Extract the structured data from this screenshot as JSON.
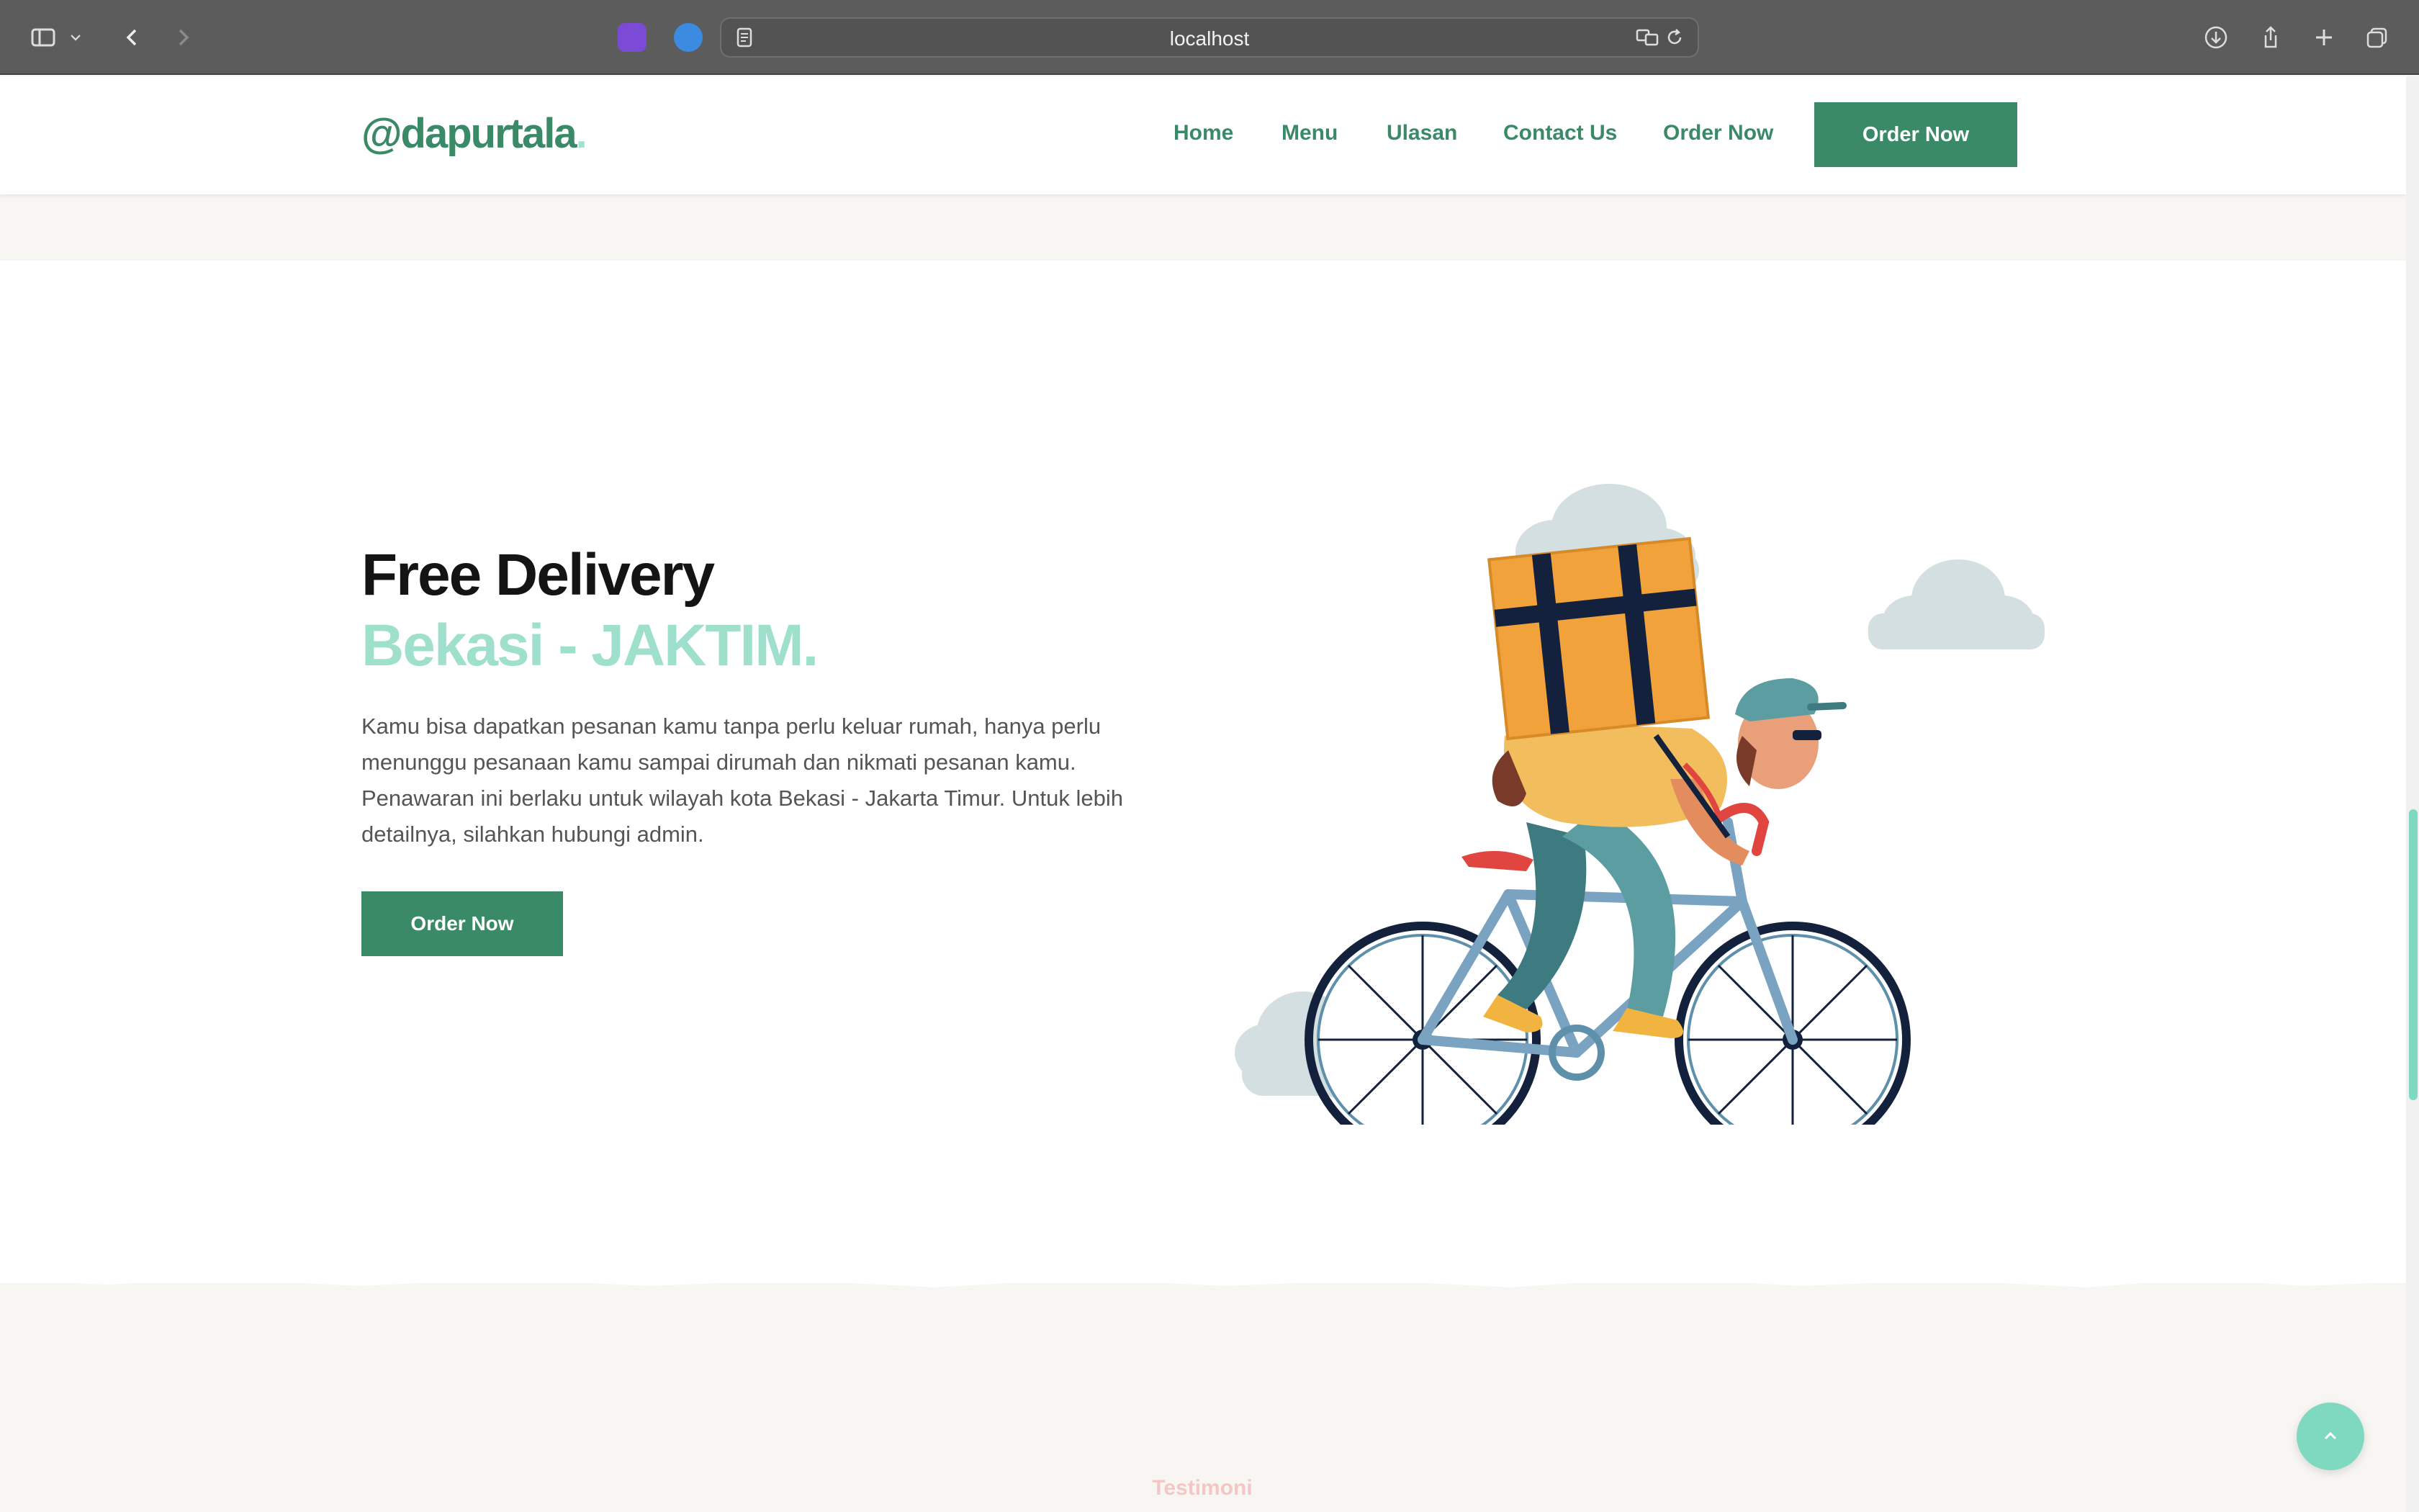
{
  "browser": {
    "url": "localhost",
    "icons": [
      "sidebar-icon",
      "chevron-down-icon",
      "back-icon",
      "forward-icon",
      "extension-icon",
      "extension-icon",
      "reader-icon",
      "translate-icon",
      "reload-icon",
      "download-icon",
      "share-icon",
      "new-tab-icon",
      "tabs-overview-icon"
    ]
  },
  "site": {
    "logo": "@dapurtala",
    "logo_dot": ".",
    "nav": [
      "Home",
      "Menu",
      "Ulasan",
      "Contact Us",
      "Order Now"
    ],
    "nav_cta": "Order Now"
  },
  "hero": {
    "title": "Free Delivery",
    "subtitle": "Bekasi - JAKTIM.",
    "description": "Kamu bisa dapatkan pesanan kamu tanpa perlu keluar rumah, hanya perlu menunggu pesanaan kamu sampai dirumah dan nikmati pesanan kamu. Penawaran ini berlaku untuk wilayah kota Bekasi - Jakarta Timur. Untuk lebih detailnya, silahkan hubungi admin.",
    "cta": "Order Now",
    "illustration": "delivery-cyclist-illustration"
  },
  "next_section": {
    "heading": "Testimoni"
  },
  "colors": {
    "brand": "#3a8a68",
    "accent": "#9ee0cc",
    "chrome": "#5c5c5c"
  }
}
